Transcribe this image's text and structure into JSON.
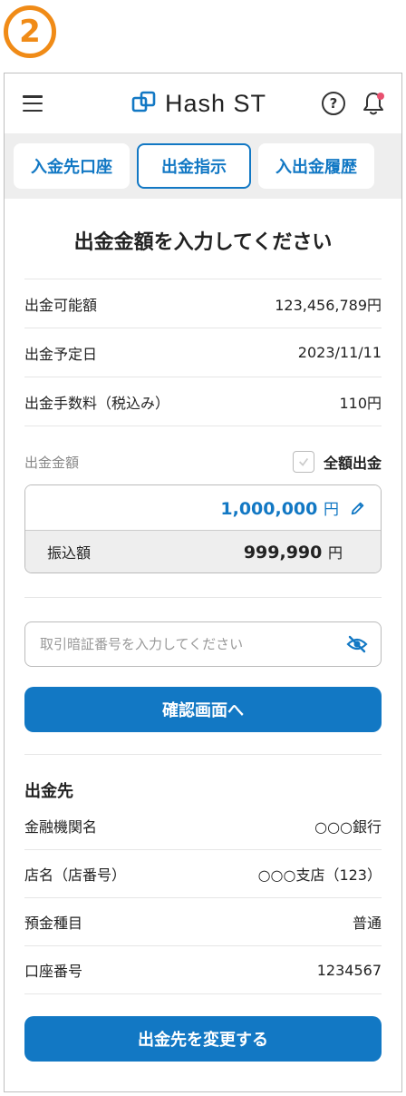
{
  "step_badge": "2",
  "header": {
    "logo_text": "Hash ST",
    "help_symbol": "?"
  },
  "tabs": [
    {
      "label": "入金先口座"
    },
    {
      "label": "出金指示"
    },
    {
      "label": "入出金履歴"
    }
  ],
  "title": "出金金額を入力してください",
  "info_rows": [
    {
      "label": "出金可能額",
      "value": "123,456,789円"
    },
    {
      "label": "出金予定日",
      "value": "2023/11/11"
    },
    {
      "label": "出金手数料（税込み）",
      "value": "110円"
    }
  ],
  "amount": {
    "label": "出金金額",
    "full_label": "全額出金",
    "value": "1,000,000",
    "unit": "円",
    "transfer_label": "振込額",
    "transfer_value": "999,990",
    "transfer_unit": "円"
  },
  "password": {
    "placeholder": "取引暗証番号を入力してください"
  },
  "confirm_button": "確認画面へ",
  "destination": {
    "title": "出金先",
    "rows": [
      {
        "label": "金融機関名",
        "value": "○○○銀行"
      },
      {
        "label": "店名（店番号）",
        "value": "○○○支店（123）"
      },
      {
        "label": "預金種目",
        "value": "普通"
      },
      {
        "label": "口座番号",
        "value": "1234567"
      }
    ]
  },
  "change_button": "出金先を変更する",
  "colors": {
    "primary": "#1278c4",
    "badge": "#f08b17",
    "notification": "#e8506f"
  }
}
